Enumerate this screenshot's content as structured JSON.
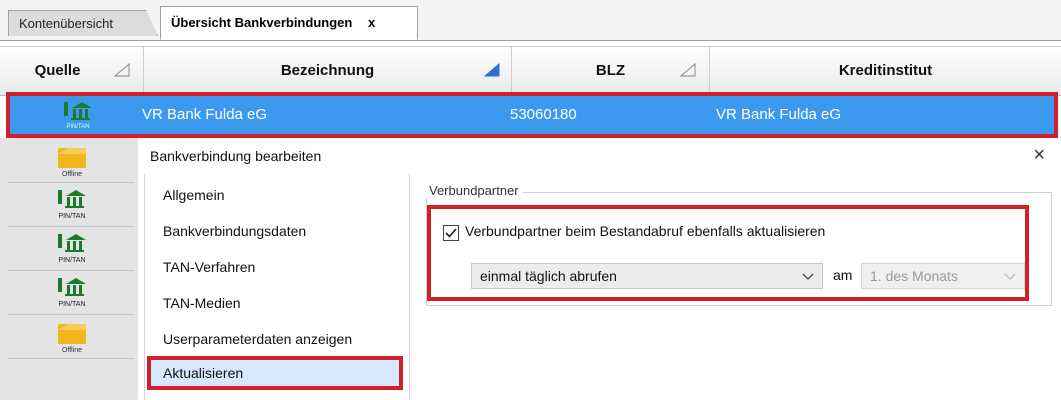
{
  "tabs": [
    {
      "label": "Kontenübersicht",
      "active": false
    },
    {
      "label": "Übersicht Bankverbindungen",
      "active": true,
      "close": "x"
    }
  ],
  "grid": {
    "columns": [
      "Quelle",
      "Bezeichnung",
      "BLZ",
      "Kreditinstitut"
    ],
    "selected_row": {
      "bezeichnung": "VR Bank Fulda eG",
      "blz": "53060180",
      "kreditinstitut": "VR Bank Fulda eG",
      "icon": "hbci-pintan-icon",
      "icon_label": "PIN/TAN"
    },
    "source_icons": [
      {
        "type": "offline",
        "label": "Offline"
      },
      {
        "type": "hbci",
        "label": "PIN/TAN"
      },
      {
        "type": "hbci",
        "label": "PIN/TAN"
      },
      {
        "type": "hbci",
        "label": "PIN/TAN"
      },
      {
        "type": "offline",
        "label": "Offline"
      }
    ]
  },
  "dialog": {
    "title": "Bankverbindung bearbeiten",
    "close": "×",
    "nav": [
      "Allgemein",
      "Bankverbindungsdaten",
      "TAN-Verfahren",
      "TAN-Medien",
      "Userparameterdaten anzeigen",
      "Aktualisieren"
    ],
    "selected_nav": "Aktualisieren",
    "group_title": "Verbundpartner",
    "checkbox_label": "Verbundpartner beim Bestandabruf ebenfalls aktualisieren",
    "checkbox_checked": true,
    "interval_value": "einmal täglich abrufen",
    "am_label": "am",
    "day_value": "1. des Monats"
  },
  "colors": {
    "selection": "#3b9af0",
    "highlight": "#d2202a",
    "nav_selected": "#d6e8fb"
  }
}
